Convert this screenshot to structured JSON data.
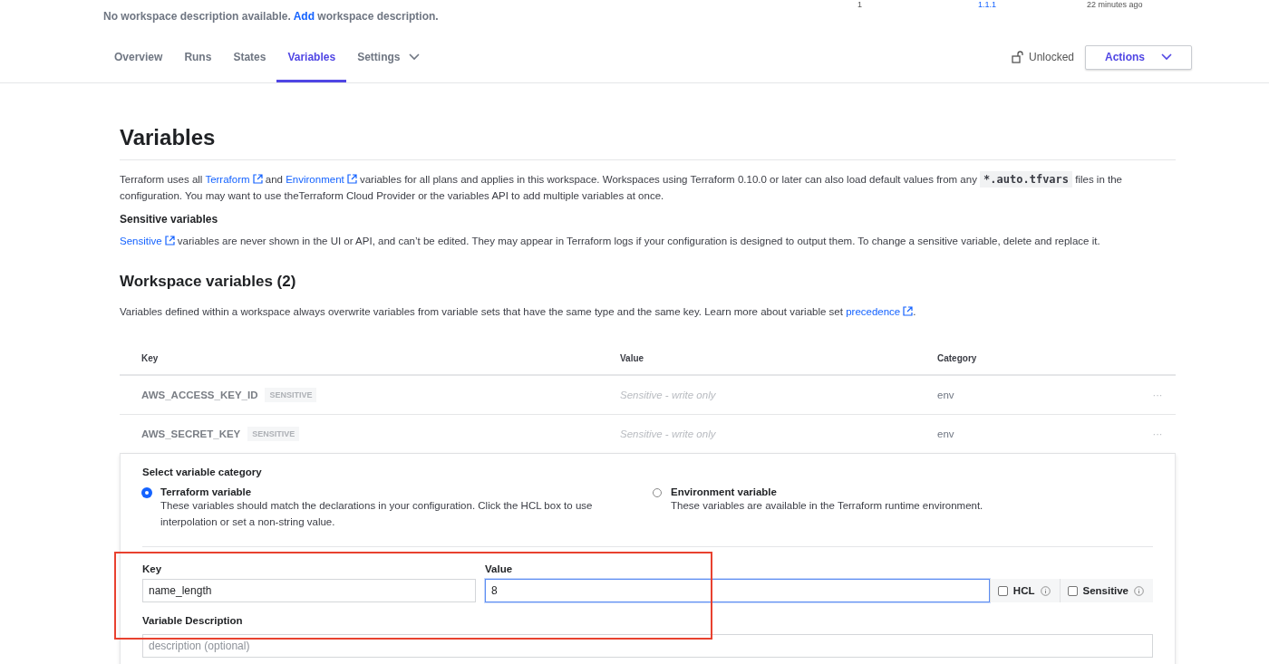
{
  "top_row": {
    "column_1": "1",
    "version": "1.1.1",
    "updated": "22 minutes ago"
  },
  "description": {
    "before": "No workspace description available.",
    "link": "Add",
    "after": "workspace description."
  },
  "tabs": [
    {
      "label": "Overview",
      "selected": false,
      "dropdown": false
    },
    {
      "label": "Runs",
      "selected": false,
      "dropdown": false
    },
    {
      "label": "States",
      "selected": false,
      "dropdown": false
    },
    {
      "label": "Variables",
      "selected": true,
      "dropdown": false
    },
    {
      "label": "Settings",
      "selected": false,
      "dropdown": true
    }
  ],
  "lock_status": "Unlocked",
  "actions_button": "Actions",
  "page_title": "Variables",
  "intro": {
    "t1": "Terraform uses all",
    "link1": "Terraform",
    "t2": "and",
    "link2": "Environment",
    "t3": "variables for all plans and applies in this workspace. Workspaces using Terraform 0.10.0 or later can also load default values from any",
    "code": "*.auto.tfvars",
    "t4": "files in the configuration. You may want to use theTerraform Cloud Provider or the variables API to add multiple variables at once."
  },
  "sensitive_heading": "Sensitive variables",
  "sensitive_note": {
    "link": "Sensitive",
    "text": "variables are never shown in the UI or API, and can’t be edited. They may appear in Terraform logs if your configuration is designed to output them. To change a sensitive variable, delete and replace it."
  },
  "workspace_heading": "Workspace variables (2)",
  "workspace_note": {
    "text": "Variables defined within a workspace always overwrite variables from variable sets that have the same type and the same key. Learn more about variable set",
    "link": "precedence",
    "end": "."
  },
  "table": {
    "columns": [
      "Key",
      "Value",
      "Category"
    ],
    "rows": [
      {
        "key": "AWS_ACCESS_KEY_ID",
        "badge": "SENSITIVE",
        "value": "Sensitive - write only",
        "category": "env",
        "menu": "···"
      },
      {
        "key": "AWS_SECRET_KEY",
        "badge": "SENSITIVE",
        "value": "Sensitive - write only",
        "category": "env",
        "menu": "···"
      }
    ]
  },
  "form": {
    "category_label": "Select variable category",
    "categories": [
      {
        "label": "Terraform variable",
        "help": "These variables should match the declarations in your configuration. Click the HCL box to use interpolation or set a non-string value.",
        "selected": true
      },
      {
        "label": "Environment variable",
        "help": "These variables are available in the Terraform runtime environment.",
        "selected": false
      }
    ],
    "key_label": "Key",
    "key_value": "name_length",
    "value_label": "Value",
    "value_value": "8",
    "options": [
      {
        "label": "HCL",
        "checked": false
      },
      {
        "label": "Sensitive",
        "checked": false
      }
    ],
    "description_label": "Variable Description",
    "description_placeholder": "description (optional)"
  }
}
